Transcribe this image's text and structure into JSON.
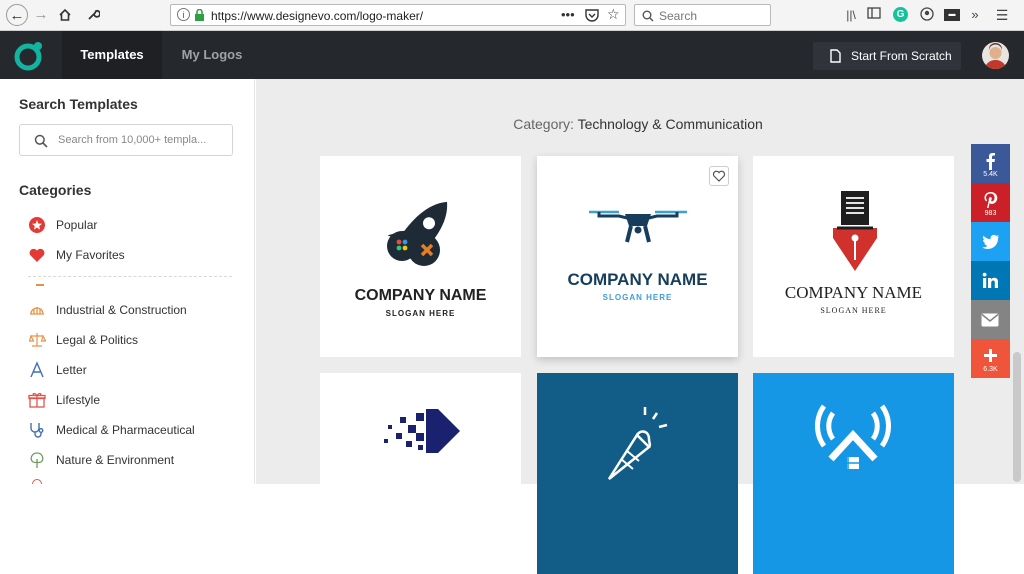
{
  "browser": {
    "url": "https://www.designevo.com/logo-maker/",
    "search_placeholder": "Search"
  },
  "header": {
    "tabs": [
      {
        "label": "Templates",
        "active": true
      },
      {
        "label": "My Logos",
        "active": false
      }
    ],
    "start_button": "Start From Scratch"
  },
  "sidebar": {
    "search_title": "Search Templates",
    "search_placeholder": "Search from 10,000+ templa...",
    "categories_title": "Categories",
    "categories": [
      {
        "label": "Popular",
        "icon": "star-icon",
        "color": "#e53935"
      },
      {
        "label": "My Favorites",
        "icon": "heart-icon",
        "color": "#e53935"
      },
      {
        "label": "Industrial & Construction",
        "icon": "helmet-icon",
        "color": "#e6934a"
      },
      {
        "label": "Legal & Politics",
        "icon": "scales-icon",
        "color": "#e6934a"
      },
      {
        "label": "Letter",
        "icon": "letter-a-icon",
        "color": "#3f6fb5"
      },
      {
        "label": "Lifestyle",
        "icon": "gift-icon",
        "color": "#e0544a"
      },
      {
        "label": "Medical & Pharmaceutical",
        "icon": "stethoscope-icon",
        "color": "#3f6fb5"
      },
      {
        "label": "Nature & Environment",
        "icon": "tree-icon",
        "color": "#6d9a5a"
      }
    ]
  },
  "main": {
    "category_key": "Category:",
    "category_value": "Technology & Communication",
    "cards": [
      {
        "name": "COMPANY NAME",
        "slogan": "SLOGAN HERE",
        "icon": "rocket-gamepad-icon"
      },
      {
        "name": "COMPANY NAME",
        "slogan": "SLOGAN HERE",
        "icon": "drone-icon"
      },
      {
        "name": "COMPANY NAME",
        "slogan": "SLOGAN HERE",
        "icon": "fountain-pen-icon"
      },
      {
        "icon": "pixel-diamond-icon"
      },
      {
        "icon": "rocket-cone-icon"
      },
      {
        "icon": "wifi-house-icon"
      }
    ]
  },
  "share": [
    {
      "network": "facebook",
      "count": "5.4K",
      "color": "#3b5998"
    },
    {
      "network": "pinterest",
      "count": "983",
      "color": "#cb2027"
    },
    {
      "network": "twitter",
      "count": "",
      "color": "#1da1f2"
    },
    {
      "network": "linkedin",
      "count": "",
      "color": "#0077b5"
    },
    {
      "network": "email",
      "count": "",
      "color": "#848484"
    },
    {
      "network": "more",
      "count": "6.3K",
      "color": "#f0553b"
    }
  ]
}
